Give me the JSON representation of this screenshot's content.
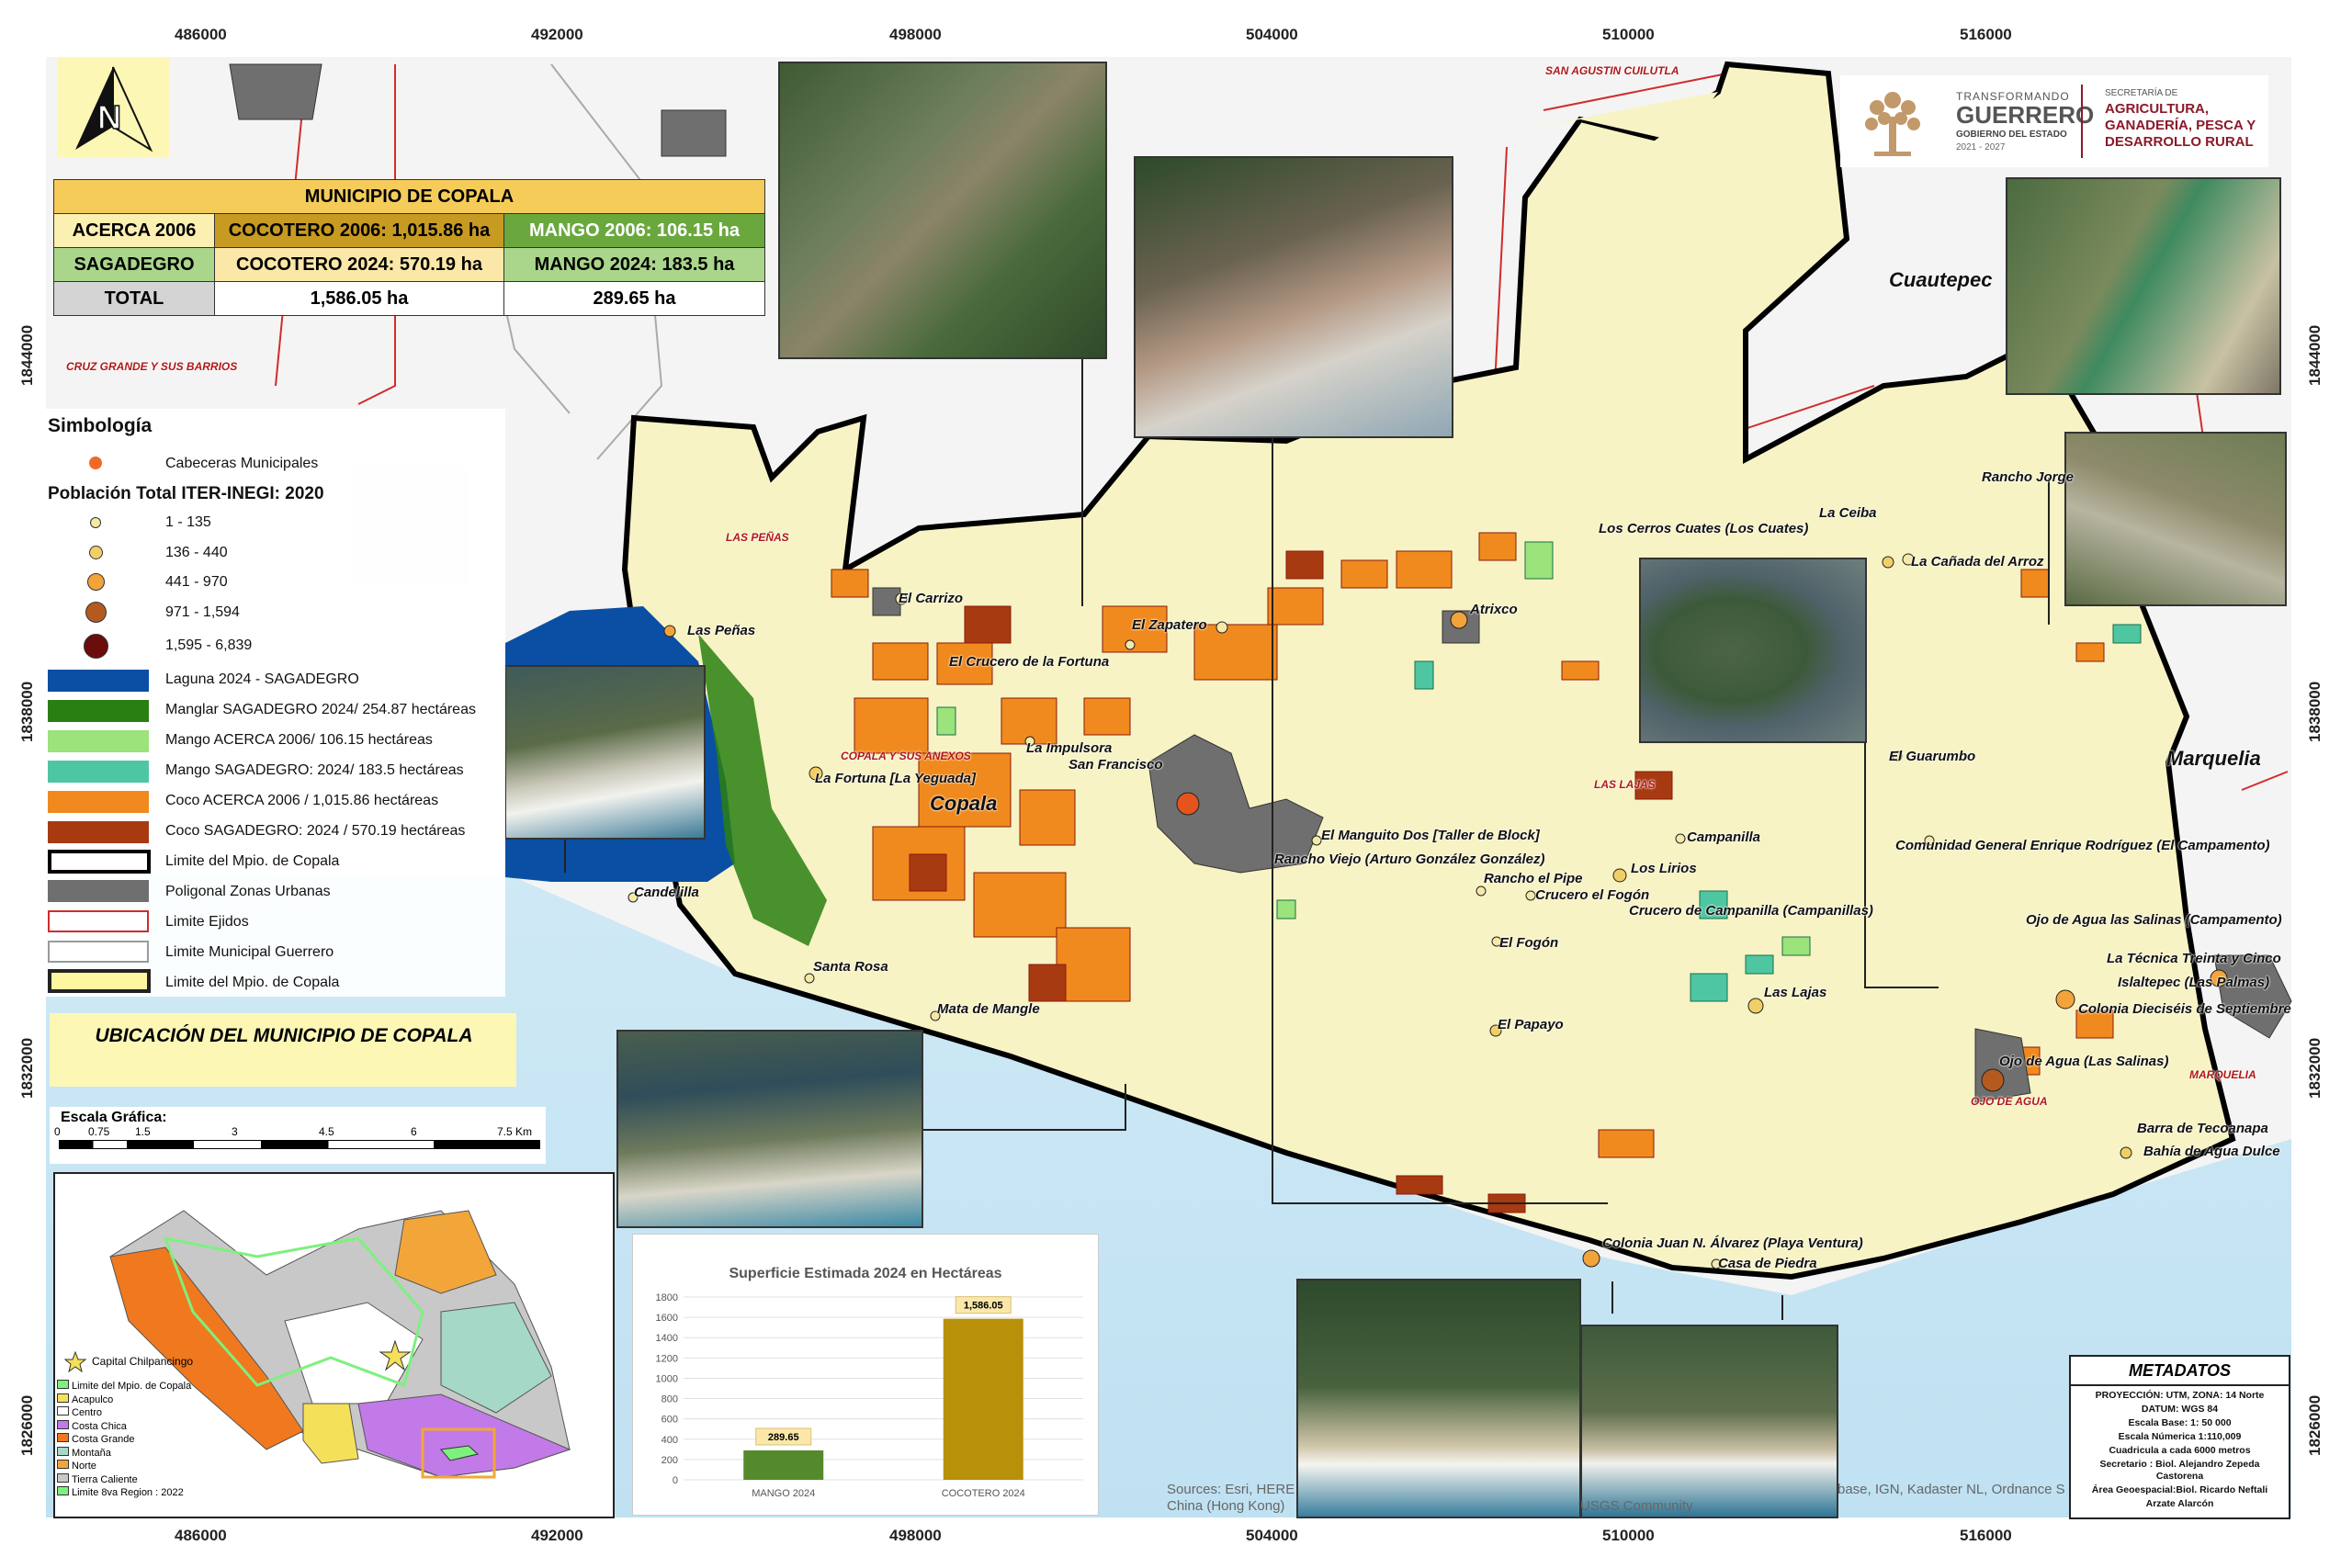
{
  "summary_table": {
    "title": "MUNICIPIO DE COPALA",
    "rows": [
      {
        "label": "ACERCA 2006",
        "cocotero": "COCOTERO 2006: 1,015.86 ha",
        "mango": "MANGO 2006: 106.15 ha"
      },
      {
        "label": "SAGADEGRO",
        "cocotero": "COCOTERO 2024: 570.19 ha",
        "mango": "MANGO 2024: 183.5 ha"
      },
      {
        "label": "TOTAL",
        "cocotero": "1,586.05 ha",
        "mango": "289.65 ha"
      }
    ]
  },
  "north_arrow": {
    "letter": "N"
  },
  "legend": {
    "title": "Simbología",
    "cabeceras": "Cabeceras Municipales",
    "population_title": "Población Total ITER-INEGI: 2020",
    "population_classes": [
      {
        "label": "1 - 135",
        "color": "#f5e9a8"
      },
      {
        "label": "136 - 440",
        "color": "#f2cf66"
      },
      {
        "label": "441 - 970",
        "color": "#f2a33a"
      },
      {
        "label": "971 - 1,594",
        "color": "#b55a1f"
      },
      {
        "label": "1,595 - 6,839",
        "color": "#6b0d0d"
      }
    ],
    "items": [
      {
        "label": "Laguna 2024 - SAGADEGRO",
        "color": "#0a4fa3"
      },
      {
        "label": "Manglar SAGADEGRO 2024/  254.87 hectáreas",
        "color": "#2a7f12"
      },
      {
        "label": "Mango ACERCA 2006/  106.15 hectáreas",
        "color": "#9be37a"
      },
      {
        "label": "Mango SAGADEGRO: 2024/ 183.5 hectáreas",
        "color": "#4fc6a2"
      },
      {
        "label": "Coco ACERCA 2006 / 1,015.86 hectáreas",
        "color": "#f08a1e"
      },
      {
        "label": "Coco SAGADEGRO: 2024 / 570.19 hectáreas",
        "color": "#a83a12"
      },
      {
        "label": "Limite del Mpio. de Copala",
        "color": "#000000"
      },
      {
        "label": "Poligonal Zonas Urbanas",
        "color": "#6f6f6f"
      },
      {
        "label": "Limite Ejidos",
        "color": "#d12c2c"
      },
      {
        "label": "Limite Municipal Guerrero",
        "color": "#9a9a9a"
      },
      {
        "label": "Limite del Mpio. de Copala",
        "color": "#fff6a0"
      }
    ]
  },
  "location_title": "UBICACIÓN DEL MUNICIPIO DE COPALA",
  "scale": {
    "title": "Escala Gráfica:",
    "labels": [
      "0",
      "0.75",
      "1.5",
      "3",
      "4.5",
      "6",
      "7.5 Km"
    ]
  },
  "inset": {
    "capital": "Capital Chilpancingo",
    "legend": [
      {
        "label": "Limite del Mpio. de Copala",
        "color": "#7ef07e"
      },
      {
        "label": "Acapulco",
        "color": "#f5e05a"
      },
      {
        "label": "Centro",
        "color": "#ffffff"
      },
      {
        "label": "Costa Chica",
        "color": "#c27ae8"
      },
      {
        "label": "Costa Grande",
        "color": "#f0781e"
      },
      {
        "label": "Montaña",
        "color": "#a6d8c8"
      },
      {
        "label": "Norte",
        "color": "#f2a63a"
      },
      {
        "label": "Tierra Caliente",
        "color": "#c8c8c8"
      },
      {
        "label": "Limite 8va Region : 2022",
        "color": "#7ef07e"
      }
    ]
  },
  "chart_data": {
    "type": "bar",
    "title": "Superficie Estimada 2024 en Hectáreas",
    "categories": [
      "MANGO 2024",
      "COCOTERO 2024"
    ],
    "values": [
      289.65,
      1586.05
    ],
    "value_labels": [
      "289.65",
      "1,586.05"
    ],
    "colors": [
      "#548a2c",
      "#b8900a"
    ],
    "ylim": [
      0,
      1800
    ],
    "yticks": [
      0,
      200,
      400,
      600,
      800,
      1000,
      1200,
      1400,
      1600,
      1800
    ],
    "grid": true
  },
  "grid_x_labels": [
    "486000",
    "492000",
    "498000",
    "504000",
    "510000",
    "516000"
  ],
  "grid_y_labels": [
    "1844000",
    "1838000",
    "1832000",
    "1826000"
  ],
  "places": [
    {
      "name": "El Carrizo"
    },
    {
      "name": "El Zapatero"
    },
    {
      "name": "Atrixco"
    },
    {
      "name": "El Crucero de la Fortuna"
    },
    {
      "name": "Las Peñas"
    },
    {
      "name": "La Impulsora"
    },
    {
      "name": "San Francisco"
    },
    {
      "name": "La Fortuna [La Yeguada]"
    },
    {
      "name": "Copala"
    },
    {
      "name": "El Manguito Dos [Taller de Block]"
    },
    {
      "name": "Rancho Viejo (Arturo González González)"
    },
    {
      "name": "Rancho el Pipe"
    },
    {
      "name": "Crucero el Fogón"
    },
    {
      "name": "Los Lirios"
    },
    {
      "name": "Campanilla"
    },
    {
      "name": "Crucero de Campanilla (Campanillas)"
    },
    {
      "name": "El Fogón"
    },
    {
      "name": "Las Lajas"
    },
    {
      "name": "El Papayo"
    },
    {
      "name": "Candelilla"
    },
    {
      "name": "Santa Rosa"
    },
    {
      "name": "Mata de Mangle"
    },
    {
      "name": "Colonia Juan N. Álvarez (Playa Ventura)"
    },
    {
      "name": "Casa de Piedra"
    },
    {
      "name": "Los Cerros Cuates (Los Cuates)"
    },
    {
      "name": "La Ceiba"
    },
    {
      "name": "Rancho Jorge"
    },
    {
      "name": "La Cañada del Arroz"
    },
    {
      "name": "El Guarumbo"
    },
    {
      "name": "Comunidad General Enrique Rodríguez (El Campamento)"
    },
    {
      "name": "Ojo de Agua las Salinas (Campamento)"
    },
    {
      "name": "La Técnica Treinta y Cinco"
    },
    {
      "name": "Islaltepec (Las Palmas)"
    },
    {
      "name": "Colonia Dieciséis de Septiembre"
    },
    {
      "name": "Ojo de Agua (Las Salinas)"
    },
    {
      "name": "Barra de Tecoanapa"
    },
    {
      "name": "Bahía de Agua Dulce"
    },
    {
      "name": "Cuautepec"
    },
    {
      "name": "Marquelia"
    }
  ],
  "red_labels": [
    "SAN AGUSTIN CUILUTLA",
    "LAS PEÑAS",
    "COPALA Y SUS ANEXOS",
    "LAS LAJAS",
    "OJO DE AGUA",
    "MARQUELIA",
    "CRUZ GRANDE Y SUS BARRIOS"
  ],
  "logo": {
    "org1": "TRANSFORMANDO",
    "org2": "GUERRERO",
    "org3": "GOBIERNO DEL ESTADO",
    "org4": "2021 - 2027",
    "sec": "SECRETARÍA DE",
    "sec1": "AGRICULTURA,",
    "sec2": "GANADERÍA, PESCA Y",
    "sec3": "DESARROLLO RURAL"
  },
  "metadata": {
    "title": "METADATOS",
    "lines": [
      "PROYECCIÓN: UTM, ZONA: 14 Norte",
      "DATUM: WGS 84",
      "Escala Base: 1: 50 000",
      "Escala Númerica 1:110,009",
      "Cuadricula a cada 6000 metros",
      "Secretario : Biol. Alejandro Zepeda",
      "Castorena",
      "Área  Geoespacial:Biol. Ricardo Neftali",
      "Arzate Alarcón"
    ]
  },
  "attribution": {
    "line1": "Sources: Esri, HERE",
    "line2": "China (Hong Kong)",
    "line3": "base, IGN, Kadaster NL, Ordnance S",
    "line4": "USGS Community"
  }
}
